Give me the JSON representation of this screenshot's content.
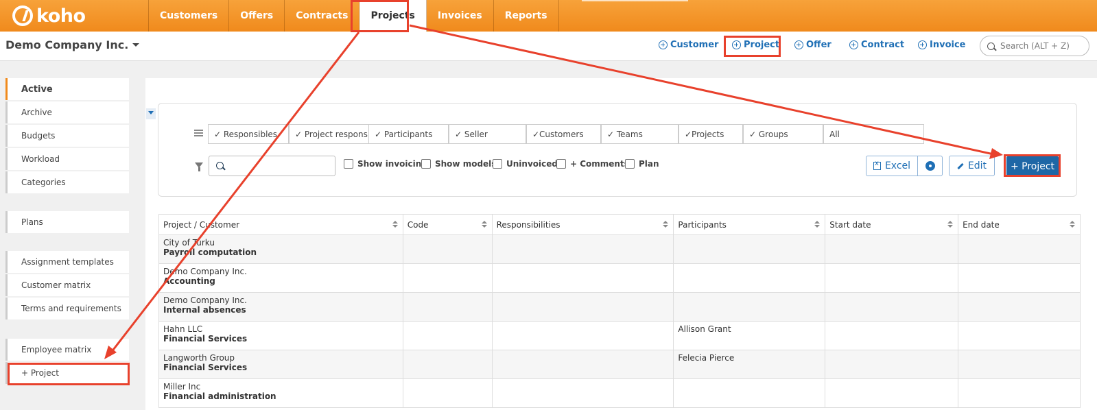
{
  "brand": {
    "name": "koho"
  },
  "nav": [
    {
      "label": "Customers"
    },
    {
      "label": "Offers"
    },
    {
      "label": "Contracts"
    },
    {
      "label": "Projects"
    },
    {
      "label": "Invoices"
    },
    {
      "label": "Reports"
    }
  ],
  "header": {
    "company": "Demo Company Inc.",
    "quick_create": [
      {
        "label": "Customer"
      },
      {
        "label": "Project"
      },
      {
        "label": "Offer"
      },
      {
        "label": "Contract"
      },
      {
        "label": "Invoice"
      }
    ],
    "search_placeholder": "Search (ALT + Z)"
  },
  "sidebar": {
    "items": [
      {
        "label": "Active"
      },
      {
        "label": "Archive"
      },
      {
        "label": "Budgets"
      },
      {
        "label": "Workload"
      },
      {
        "label": "Categories"
      },
      {
        "label": "Plans"
      },
      {
        "label": "Assignment templates"
      },
      {
        "label": "Customer matrix"
      },
      {
        "label": "Terms and requirements"
      },
      {
        "label": "Employee matrix"
      },
      {
        "label": "+ Project"
      }
    ]
  },
  "filters": {
    "chips": [
      {
        "label": "✓ Responsibles"
      },
      {
        "label": "✓ Project responsibilities"
      },
      {
        "label": "✓ Participants"
      },
      {
        "label": "✓ Seller"
      },
      {
        "label": "✓Customers"
      },
      {
        "label": "✓ Teams"
      },
      {
        "label": "✓Projects"
      },
      {
        "label": "✓ Groups"
      },
      {
        "label": "All"
      }
    ],
    "checkboxes": [
      {
        "label": "Show invoicing"
      },
      {
        "label": "Show models"
      },
      {
        "label": "Uninvoiced"
      },
      {
        "label": "+ Comments"
      },
      {
        "label": "Plan"
      }
    ],
    "excel_label": "Excel",
    "edit_label": "Edit",
    "add_label": "+ Project"
  },
  "table": {
    "columns": [
      "Project / Customer",
      "Code",
      "Responsibilities",
      "Participants",
      "Start date",
      "End date"
    ],
    "rows": [
      {
        "customer": "City of Turku",
        "project": "Payroll computation",
        "code": "",
        "responsibilities": "",
        "participants": "",
        "start": "",
        "end": ""
      },
      {
        "customer": "Demo Company Inc.",
        "project": "Accounting",
        "code": "",
        "responsibilities": "",
        "participants": "",
        "start": "",
        "end": ""
      },
      {
        "customer": "Demo Company Inc.",
        "project": "Internal absences",
        "code": "",
        "responsibilities": "",
        "participants": "",
        "start": "",
        "end": ""
      },
      {
        "customer": "Hahn LLC",
        "project": "Financial Services",
        "code": "",
        "responsibilities": "",
        "participants": "Allison Grant",
        "start": "",
        "end": ""
      },
      {
        "customer": "Langworth Group",
        "project": "Financial Services",
        "code": "",
        "responsibilities": "",
        "participants": "Felecia Pierce",
        "start": "",
        "end": ""
      },
      {
        "customer": "Miller Inc",
        "project": "Financial administration",
        "code": "",
        "responsibilities": "",
        "participants": "",
        "start": "",
        "end": ""
      }
    ]
  },
  "colors": {
    "accent": "#f08a1c",
    "link": "#1f6fb5",
    "primary_button": "#1e67a6",
    "annotation": "#e8412c"
  }
}
